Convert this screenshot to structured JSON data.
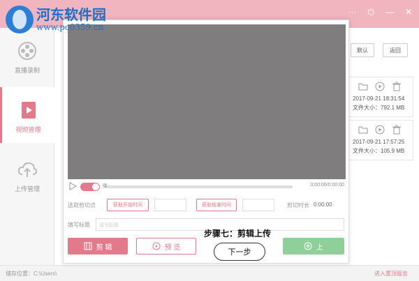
{
  "watermark": {
    "title": "河东软件园",
    "url": "www.pc0359.cn"
  },
  "sidebar": {
    "items": [
      {
        "label": "直播录制",
        "active": false,
        "icon": "film-reel-icon"
      },
      {
        "label": "视频管理",
        "active": true,
        "icon": "video-file-icon"
      },
      {
        "label": "上传管理",
        "active": false,
        "icon": "cloud-upload-icon"
      }
    ]
  },
  "toolbar": {
    "default_label": "默认",
    "back_label": "返回"
  },
  "files": [
    {
      "date": "2017-09-21 18:31:54",
      "size": "文件大小：792.1 MB"
    },
    {
      "date": "2017-09-21 17:57:25",
      "size": "文件大小：105.9 MB"
    }
  ],
  "editor": {
    "toggle_label": "降",
    "timecode": "0:00:00/0:00:00",
    "cut_point_label": "选取剪切点",
    "get_start_label": "获取开始时间",
    "get_end_label": "获取结束时间",
    "cut_duration_label": "剪切时长",
    "cut_duration_value": "0:00:00",
    "title_label": "填写标题",
    "title_placeholder": "请写标题",
    "cut_button": "剪 辑",
    "preview_button": "预 览",
    "upload_button": "上"
  },
  "tutorial": {
    "step": "步骤七：剪辑上传",
    "next_button": "下一步"
  },
  "status": {
    "path_label": "储存位置：C:\\Users\\",
    "link_right": "进入置顶服务"
  },
  "colors": {
    "accent": "#e27a8b",
    "titlebar": "#f0b5bf",
    "upload": "#8fd09a",
    "video": "#7f7d7e"
  }
}
